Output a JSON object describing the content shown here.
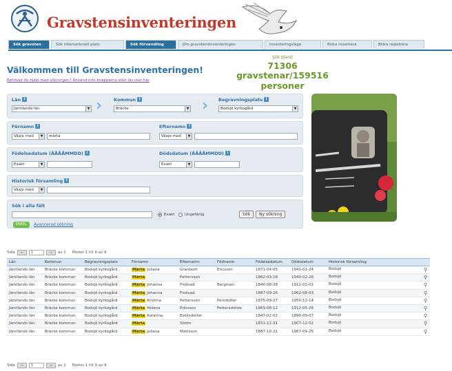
{
  "header": {
    "site_title": "Gravstensinventeringen"
  },
  "nav": {
    "tabs": [
      {
        "label": "Sök gravsten",
        "active": true
      },
      {
        "label": "Sök internationell plats",
        "active": false
      },
      {
        "label": "Sök förvandling",
        "active": true
      },
      {
        "label": "Om gravstensinventeringen",
        "active": false
      },
      {
        "label": "Inventeringsläge",
        "active": false
      },
      {
        "label": "Bidra inventera",
        "active": false
      },
      {
        "label": "Bidra registrera",
        "active": false
      }
    ]
  },
  "welcome": {
    "heading": "Välkommen till Gravstensinventeringen!",
    "help_link": "Behöver du hjälp med sökningen? Använd info-knapparna eller läs mer här"
  },
  "stats": {
    "label": "Sök bland",
    "count": "71306 gravstenar/159516",
    "unit": "personer"
  },
  "form": {
    "lan": {
      "label": "Län",
      "value": "Jämtlands län"
    },
    "kommun": {
      "label": "Kommun",
      "value": "Bräcke"
    },
    "begravningsplats": {
      "label": "Begravningsplats",
      "value": "Bodsjö kyrkogård"
    },
    "fornamn": {
      "label": "Förnamn",
      "mode": "Växje med",
      "value": "märta"
    },
    "efternamn": {
      "label": "Efternamn",
      "mode": "Växje med",
      "value": ""
    },
    "fodelsedatum": {
      "label": "Födelsedatum (ÅÅÅÅMMDD)",
      "mode": "Exakt",
      "value": ""
    },
    "dodsdatum": {
      "label": "Dödsdatum (ÅÅÅÅMMDD)",
      "mode": "Exakt",
      "value": ""
    },
    "historisk": {
      "label": "Historisk församling",
      "mode": "Växje med",
      "value": ""
    },
    "search_all": {
      "label": "Sök i alla fält",
      "value": ""
    },
    "radio_exact": "Exakt",
    "radio_approx": "Ungefärlig",
    "search_button": "Sök",
    "new_search_button": "Ny sökning",
    "toggle_label": "ENKEL",
    "advanced_link": "Avancerad sökning",
    "info_icon": "info-icon"
  },
  "pager_top": {
    "sida": "Sida",
    "page": "1",
    "av": "av 1",
    "info": "Poster 1 till 9 av 9"
  },
  "pager_bottom": {
    "sida": "Sida",
    "page": "1",
    "av": "av 1",
    "info": "Poster 1 till 9 av 9"
  },
  "table": {
    "columns": [
      "Län",
      "Kommun",
      "Begravningsplats",
      "Förnamn",
      "Efternamn",
      "Födnamn",
      "Födelsedatum",
      "Dödsdatum",
      "Historisk församling"
    ],
    "rows": [
      [
        "Jämtlands län",
        "Bräcke kommun",
        "Bodsjö kyrkogård",
        "Märta",
        "Juliana",
        "Granbom",
        "Ericsson",
        "1871-04-05",
        "1941-01-24",
        "Bodsjö"
      ],
      [
        "Jämtlands län",
        "Bräcke kommun",
        "Bodsjö kyrkogård",
        "Märta",
        "",
        "Pettersson",
        "",
        "1862-03-18",
        "1940-02-20",
        "Bodsjö"
      ],
      [
        "Jämtlands län",
        "Bräcke kommun",
        "Bodsjö kyrkogård",
        "Märta",
        "Johanna",
        "Flodvad",
        "Bergman",
        "1840-08-28",
        "1912-02-02",
        "Bodsjö"
      ],
      [
        "Jämtlands län",
        "Bräcke kommun",
        "Bodsjö kyrkogård",
        "Märta",
        "Johanna",
        "Flodvad",
        "",
        "1887-09-26",
        "1962-08-03",
        "Bodsjö"
      ],
      [
        "Jämtlands län",
        "Bräcke kommun",
        "Bodsjö kyrkogård",
        "Märta",
        "Kristina",
        "Pettersson",
        "Persdotter",
        "1875-09-27",
        "1950-12-14",
        "Bodsjö"
      ],
      [
        "Jämtlands län",
        "Bräcke kommun",
        "Bodsjö kyrkogård",
        "Märta",
        "Helena",
        "Eriksson",
        "Pettersdotter",
        "1869-08-12",
        "1912-05-26",
        "Bodsjö"
      ],
      [
        "Jämtlands län",
        "Bräcke kommun",
        "Bodsjö kyrkogård",
        "Märta",
        "Katarina",
        "Eskilsdotter",
        "",
        "1847-02-02",
        "1890-09-07",
        "Bodsjö"
      ],
      [
        "Jämtlands län",
        "Bräcke kommun",
        "Bodsjö kyrkogård",
        "Märta",
        "",
        "Ström",
        "",
        "1831-12-31",
        "1907-12-02",
        "Bodsjö"
      ],
      [
        "Jämtlands län",
        "Bräcke kommun",
        "Bodsjö kyrkogård",
        "Märta",
        "Juliana",
        "Mattsson",
        "",
        "1887-10-21",
        "1967-09-25",
        "Bodsjö"
      ]
    ]
  },
  "colors": {
    "title_red": "#c0392b",
    "link_blue": "#2e6fa8",
    "stats_green": "#6a9a2a",
    "nav_active": "#2b6f9e",
    "highlight": "#f2d400"
  }
}
